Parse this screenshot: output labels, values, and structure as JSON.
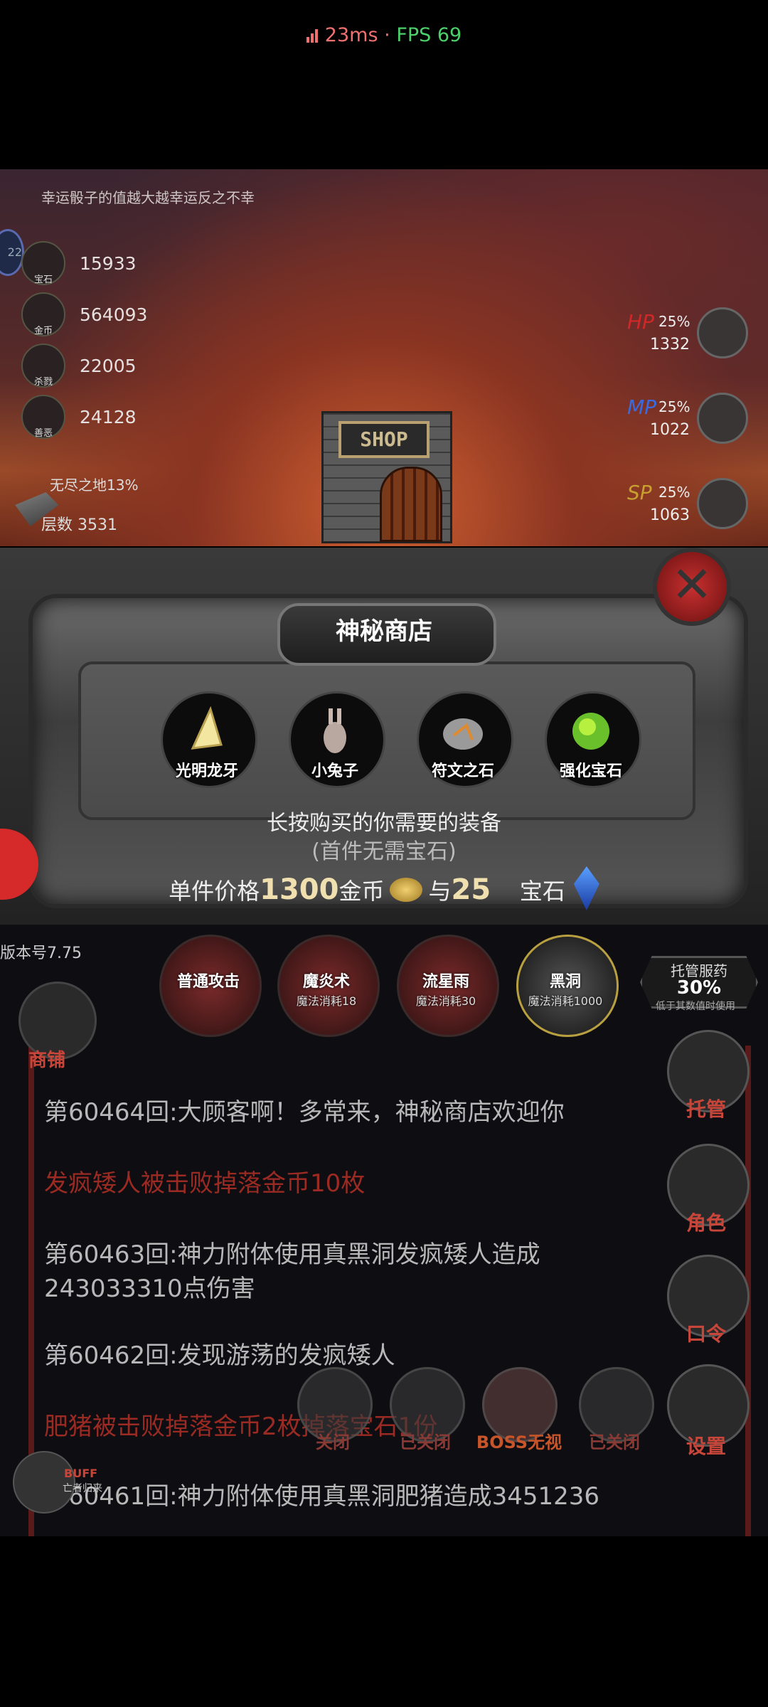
{
  "status": {
    "ping": "23ms",
    "sep": "·",
    "fps": "FPS 69"
  },
  "scene": {
    "luck_text": "幸运骰子的值越大越幸运反之不幸",
    "left_badge": "22",
    "resources": [
      {
        "label": "宝石",
        "value": "15933",
        "icon": "gem-icon"
      },
      {
        "label": "金币",
        "value": "564093",
        "icon": "coin-icon"
      },
      {
        "label": "杀戮",
        "value": "22005",
        "icon": "skull-icon"
      },
      {
        "label": "善恶",
        "value": "24128",
        "icon": "mask-icon"
      }
    ],
    "end_land": "无尽之地13%",
    "floor": "层数 3531",
    "stats": [
      {
        "name": "HP",
        "pct": "25%",
        "value": "1332",
        "color": "#d02828"
      },
      {
        "name": "MP",
        "pct": "25%",
        "value": "1022",
        "color": "#3a6ae0"
      },
      {
        "name": "SP",
        "pct": "25%",
        "value": "1063",
        "color": "#c8a030"
      }
    ],
    "shop_sign": "SHOP"
  },
  "modal": {
    "title": "神秘商店",
    "close": "✕",
    "items": [
      {
        "name": "光明龙牙",
        "icon": "dragon-fang-icon"
      },
      {
        "name": "小兔子",
        "icon": "rabbit-icon"
      },
      {
        "name": "符文之石",
        "icon": "rune-stone-icon"
      },
      {
        "name": "强化宝石",
        "icon": "enhance-gem-icon"
      }
    ],
    "hint_line1": "长按购买的你需要的装备",
    "hint_line2": "(首件无需宝石)",
    "price_prefix": "单件价格",
    "price_gold": "1300",
    "price_gold_unit": "金币",
    "price_and": "与",
    "price_gem": "25",
    "price_gem_unit": "宝石"
  },
  "panel": {
    "version": "版本号7.75",
    "skills": [
      {
        "name": "普通攻击",
        "cost": ""
      },
      {
        "name": "魔炎术",
        "cost": "魔法消耗18"
      },
      {
        "name": "流星雨",
        "cost": "魔法消耗30"
      },
      {
        "name": "黑洞",
        "cost": "魔法消耗1000"
      }
    ],
    "auto_potion": {
      "title": "托管服药",
      "value": "30%",
      "note": "低于其数值时使用"
    },
    "shop_label": "商铺",
    "log": [
      {
        "text": "第60464回:大顾客啊！多常来，神秘商店欢迎你",
        "red": false
      },
      {
        "text": "发疯矮人被击败掉落金币10枚",
        "red": true
      },
      {
        "text": "第60463回:神力附体使用真黑洞发疯矮人造成243033310点伤害",
        "red": false
      },
      {
        "text": "第60462回:发现游荡的发疯矮人",
        "red": false
      },
      {
        "text": "肥猪被击败掉落金币2枚掉落宝石1份",
        "red": true
      },
      {
        "text": "第60461回:神力附体使用真黑洞肥猪造成3451236",
        "red": false
      }
    ],
    "side_buttons": [
      "托管",
      "角色",
      "口令",
      "设置"
    ],
    "bottom_buttons": [
      "关闭",
      "已关闭",
      "BOSS无视",
      "已关闭"
    ],
    "buff": {
      "label": "BUFF",
      "sub": "亡者归来"
    }
  }
}
